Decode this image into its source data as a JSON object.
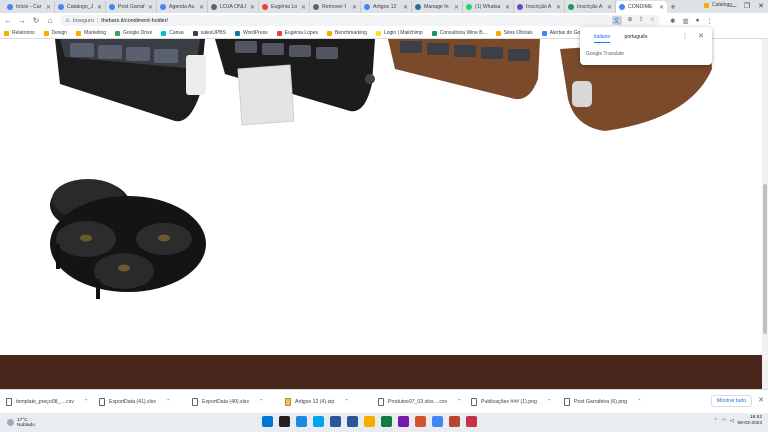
{
  "tabs": [
    {
      "title": "Início - Car",
      "color": "#4285f4"
    },
    {
      "title": "Catalogo_J",
      "color": "#4285f4"
    },
    {
      "title": "Post Garraf",
      "color": "#4285f4"
    },
    {
      "title": "Agenda Au",
      "color": "#4285f4"
    },
    {
      "title": "LOJA ONLI",
      "color": "#5f6368"
    },
    {
      "title": "Eugénia Lo",
      "color": "#ea4335"
    },
    {
      "title": "Remover f",
      "color": "#5f6368"
    },
    {
      "title": "Artigos 12",
      "color": "#4285f4"
    },
    {
      "title": "Manage In",
      "color": "#21759b"
    },
    {
      "title": "(1) Whatsa",
      "color": "#25d366"
    },
    {
      "title": "Inscrição A",
      "color": "#7248b9"
    },
    {
      "title": "Inscrição A",
      "color": "#0f9d58"
    },
    {
      "title": "CONDIME",
      "color": "#4285f4"
    }
  ],
  "toolbar": {
    "security": "Inseguro",
    "url": "thebars.it/condiment-holder/"
  },
  "bookmarks": [
    {
      "label": "Relatorios",
      "color": "#f9ab00"
    },
    {
      "label": "Design",
      "color": "#f9ab00"
    },
    {
      "label": "Marketing",
      "color": "#f9ab00"
    },
    {
      "label": "Google Drive",
      "color": "#34a853"
    },
    {
      "label": "Canva",
      "color": "#00c4cc"
    },
    {
      "label": "salesUPBS",
      "color": "#3c4043"
    },
    {
      "label": "WordPress",
      "color": "#21759b"
    },
    {
      "label": "Eugénia Lopes",
      "color": "#ea4335"
    },
    {
      "label": "Benchmarking",
      "color": "#f9ab00"
    },
    {
      "label": "Login | Mailchimp",
      "color": "#ffe01b"
    },
    {
      "label": "Consultoria Wine B...",
      "color": "#0f9d58"
    },
    {
      "label": "Sites Oficiais",
      "color": "#f9ab00"
    },
    {
      "label": "Alertas do Google",
      "color": "#4285f4"
    },
    {
      "label": "Al",
      "color": "#f9ab00"
    }
  ],
  "bookmarks_right": "Catalogo",
  "translate_popup": {
    "lang_from": "italiano",
    "lang_to": "português",
    "provider": "Google Translate"
  },
  "downloads": [
    {
      "name": "template_preço08_....csv",
      "type": "doc"
    },
    {
      "name": "ExportData (41).xlsx",
      "type": "doc"
    },
    {
      "name": "ExportData (40).xlsx",
      "type": "doc"
    },
    {
      "name": "Artigos 12 (4).zip",
      "type": "zip"
    },
    {
      "name": "Produtos07_03.xlsx....csv",
      "type": "doc"
    },
    {
      "name": "Publicações ### (1).png",
      "type": "doc"
    },
    {
      "name": "Post Garrafeira (6).png",
      "type": "doc"
    }
  ],
  "show_all_label": "Mostrar tudo",
  "taskbar": {
    "temp": "17°C",
    "weather": "Nublado",
    "time": "16:52",
    "date": "08-03-2023",
    "apps": [
      "#0078d4",
      "#222",
      "#1e88e5",
      "#00a4ef",
      "#2b579a",
      "#2b579a",
      "#f9ab00",
      "#107c41",
      "#7719aa",
      "#d35230",
      "#4285f4",
      "#b7472a",
      "#c4314b"
    ]
  }
}
